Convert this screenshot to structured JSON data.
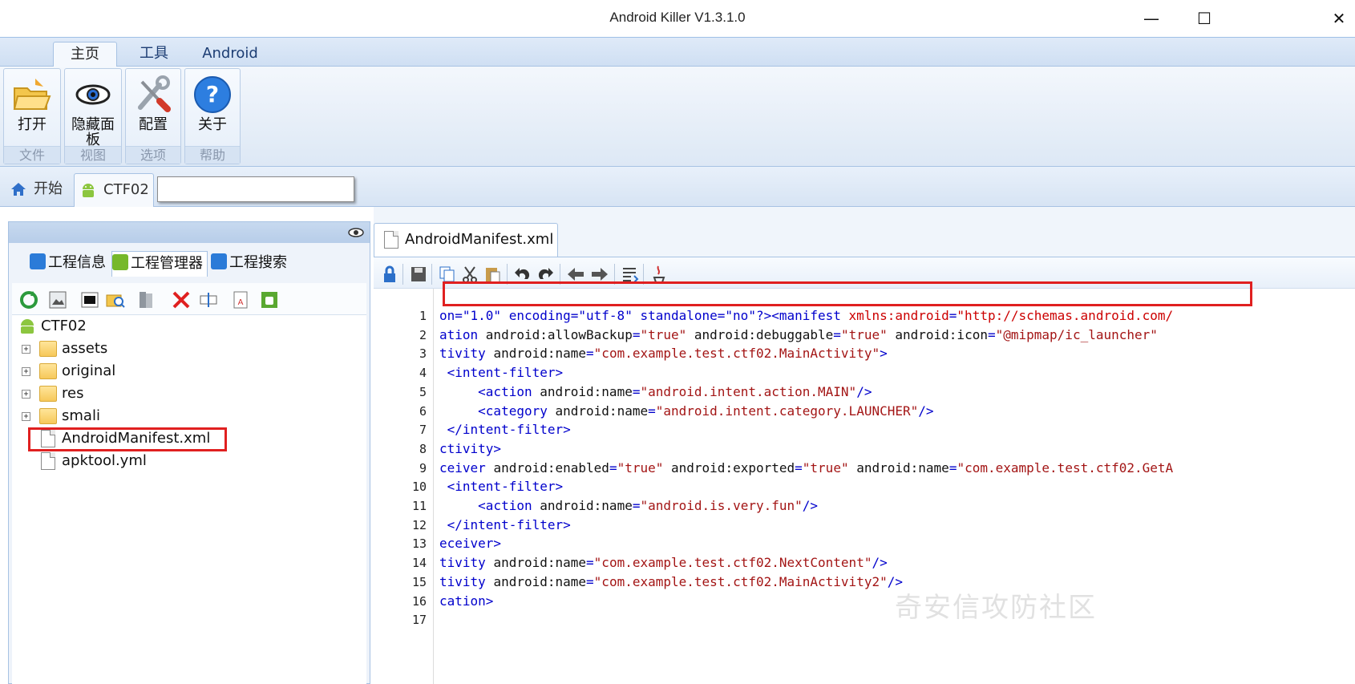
{
  "window": {
    "title": "Android Killer V1.3.1.0",
    "minimize": "—",
    "maximize": "☐",
    "close": "✕"
  },
  "ribbon": {
    "tabs": [
      {
        "label": "主页",
        "active": true
      },
      {
        "label": "工具"
      },
      {
        "label": "Android"
      }
    ],
    "groups": [
      {
        "name": "文件",
        "button": "打开",
        "icon": "folder-open-icon"
      },
      {
        "name": "视图",
        "button": "隐藏面板",
        "icon": "eye-icon"
      },
      {
        "name": "选项",
        "button": "配置",
        "icon": "tools-icon"
      },
      {
        "name": "帮助",
        "button": "关于",
        "icon": "help-icon"
      }
    ]
  },
  "doc_tabs": [
    {
      "label": "开始",
      "icon": "home-icon"
    },
    {
      "label": "CTF02",
      "icon": "android-icon",
      "active": true
    }
  ],
  "left_panel": {
    "tabs": [
      {
        "label": "工程信息",
        "icon": "info-icon"
      },
      {
        "label": "工程管理器",
        "icon": "android-icon",
        "active": true
      },
      {
        "label": "工程搜索",
        "icon": "search-icon"
      }
    ],
    "tree": {
      "root": "CTF02",
      "items": [
        {
          "label": "assets",
          "type": "folder"
        },
        {
          "label": "original",
          "type": "folder"
        },
        {
          "label": "res",
          "type": "folder"
        },
        {
          "label": "smali",
          "type": "folder"
        },
        {
          "label": "AndroidManifest.xml",
          "type": "file",
          "highlighted": true
        },
        {
          "label": "apktool.yml",
          "type": "file"
        }
      ]
    }
  },
  "editor": {
    "tab": "AndroidManifest.xml",
    "watermark": "奇安信攻防社区",
    "lines": [
      {
        "n": "1",
        "seg": [
          [
            "tg",
            "on=\"1.0\" encoding=\"utf-8\" standalone=\"no\"?><manifest "
          ],
          [
            "xm",
            "xmlns:android"
          ],
          [
            "tg",
            "="
          ],
          [
            "xm",
            "\"http://schemas.android.com/"
          ]
        ]
      },
      {
        "n": "2",
        "seg": [
          [
            "tg",
            "ation "
          ],
          [
            "at",
            "android:allowBackup"
          ],
          [
            "tg",
            "="
          ],
          [
            "vl",
            "\"true\""
          ],
          [
            "at",
            " android:debuggable"
          ],
          [
            "tg",
            "="
          ],
          [
            "vl",
            "\"true\""
          ],
          [
            "at",
            " android:icon"
          ],
          [
            "tg",
            "="
          ],
          [
            "vl",
            "\"@mipmap/ic_launcher\""
          ]
        ]
      },
      {
        "n": "3",
        "seg": [
          [
            "tg",
            "tivity "
          ],
          [
            "at",
            "android:name"
          ],
          [
            "tg",
            "="
          ],
          [
            "vl",
            "\"com.example.test.ctf02.MainActivity\""
          ],
          [
            "tg",
            ">"
          ]
        ]
      },
      {
        "n": "4",
        "seg": [
          [
            "tg",
            " <intent-filter>"
          ]
        ]
      },
      {
        "n": "5",
        "seg": [
          [
            "tg",
            "     <action "
          ],
          [
            "at",
            "android:name"
          ],
          [
            "tg",
            "="
          ],
          [
            "vl",
            "\"android.intent.action.MAIN\""
          ],
          [
            "tg",
            "/>"
          ]
        ]
      },
      {
        "n": "6",
        "seg": [
          [
            "tg",
            "     <category "
          ],
          [
            "at",
            "android:name"
          ],
          [
            "tg",
            "="
          ],
          [
            "vl",
            "\"android.intent.category.LAUNCHER\""
          ],
          [
            "tg",
            "/>"
          ]
        ]
      },
      {
        "n": "7",
        "seg": [
          [
            "tg",
            " </intent-filter>"
          ]
        ]
      },
      {
        "n": "8",
        "seg": [
          [
            "tg",
            "ctivity>"
          ]
        ]
      },
      {
        "n": "9",
        "seg": [
          [
            "tg",
            "ceiver "
          ],
          [
            "at",
            "android:enabled"
          ],
          [
            "tg",
            "="
          ],
          [
            "vl",
            "\"true\""
          ],
          [
            "at",
            " android:exported"
          ],
          [
            "tg",
            "="
          ],
          [
            "vl",
            "\"true\""
          ],
          [
            "at",
            " android:name"
          ],
          [
            "tg",
            "="
          ],
          [
            "vl",
            "\"com.example.test.ctf02.GetA"
          ]
        ]
      },
      {
        "n": "10",
        "seg": [
          [
            "tg",
            " <intent-filter>"
          ]
        ]
      },
      {
        "n": "11",
        "seg": [
          [
            "tg",
            "     <action "
          ],
          [
            "at",
            "android:name"
          ],
          [
            "tg",
            "="
          ],
          [
            "vl",
            "\"android.is.very.fun\""
          ],
          [
            "tg",
            "/>"
          ]
        ]
      },
      {
        "n": "12",
        "seg": [
          [
            "tg",
            " </intent-filter>"
          ]
        ]
      },
      {
        "n": "13",
        "seg": [
          [
            "tg",
            "eceiver>"
          ]
        ]
      },
      {
        "n": "14",
        "seg": [
          [
            "tg",
            "tivity "
          ],
          [
            "at",
            "android:name"
          ],
          [
            "tg",
            "="
          ],
          [
            "vl",
            "\"com.example.test.ctf02.NextContent\""
          ],
          [
            "tg",
            "/>"
          ]
        ]
      },
      {
        "n": "15",
        "seg": [
          [
            "tg",
            "tivity "
          ],
          [
            "at",
            "android:name"
          ],
          [
            "tg",
            "="
          ],
          [
            "vl",
            "\"com.example.test.ctf02.MainActivity2\""
          ],
          [
            "tg",
            "/>"
          ]
        ]
      },
      {
        "n": "16",
        "seg": [
          [
            "tg",
            "cation>"
          ]
        ]
      },
      {
        "n": "17",
        "seg": []
      }
    ]
  },
  "colors": {
    "highlight_box": "#e02020",
    "tag": "#0000cc",
    "value": "#a31515",
    "ribbon_border": "#a7c2e3"
  }
}
